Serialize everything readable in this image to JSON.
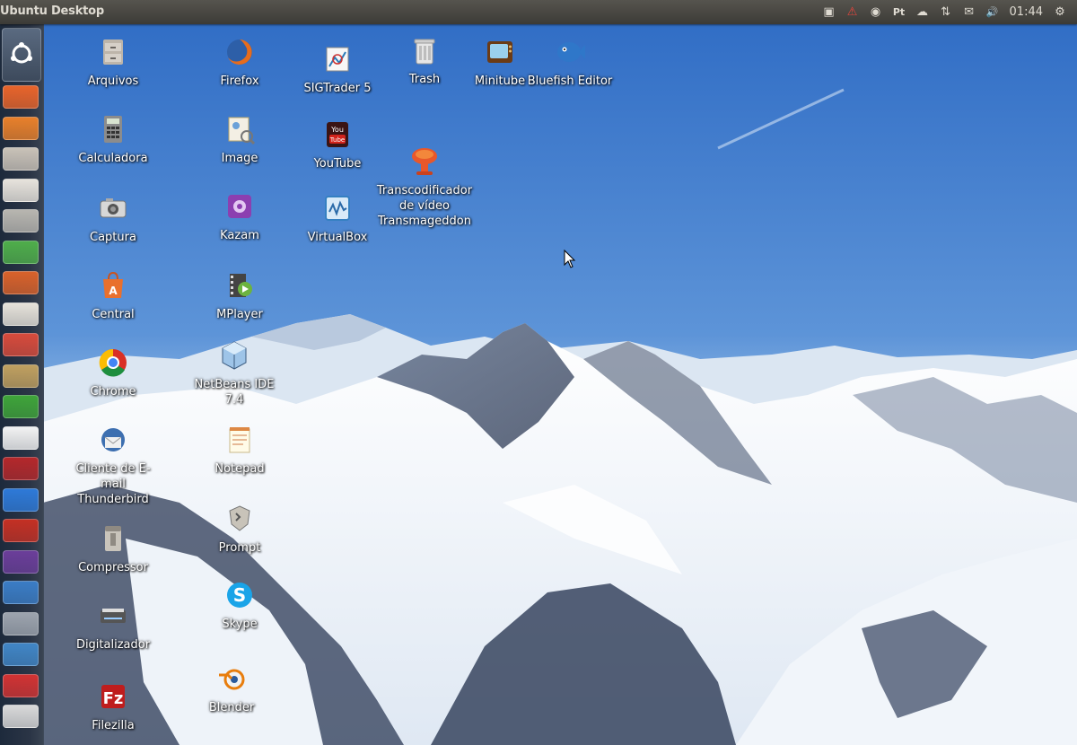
{
  "panel": {
    "title": "Ubuntu Desktop",
    "clock": "01:44",
    "indicators": [
      {
        "name": "screen-record-icon",
        "glyph": "▣"
      },
      {
        "name": "warning-icon",
        "glyph": "⚠"
      },
      {
        "name": "update-icon",
        "glyph": "◉"
      },
      {
        "name": "pt-keyboard-icon",
        "glyph": "Pt"
      },
      {
        "name": "cloud-icon",
        "glyph": "☁"
      },
      {
        "name": "network-icon",
        "glyph": "⇅"
      },
      {
        "name": "mail-icon",
        "glyph": "✉"
      },
      {
        "name": "volume-icon",
        "glyph": "🔊"
      },
      {
        "name": "settings-gear-icon",
        "glyph": "⚙"
      }
    ]
  },
  "launcher_items": [
    {
      "name": "launcher-software-center",
      "color": "#e8642b"
    },
    {
      "name": "launcher-firefox",
      "color": "#e8802b"
    },
    {
      "name": "launcher-files",
      "color": "#c9c2b8"
    },
    {
      "name": "launcher-writer",
      "color": "#e7e3dc"
    },
    {
      "name": "launcher-calculator",
      "color": "#b8b6b0"
    },
    {
      "name": "launcher-calc",
      "color": "#4fae4b"
    },
    {
      "name": "launcher-impress",
      "color": "#d9622b"
    },
    {
      "name": "launcher-presentation",
      "color": "#e6e2da"
    },
    {
      "name": "launcher-burner",
      "color": "#d84b3c"
    },
    {
      "name": "launcher-ftp",
      "color": "#c0a060"
    },
    {
      "name": "launcher-chat",
      "color": "#3fa43a"
    },
    {
      "name": "launcher-gmail",
      "color": "#f2f2f2"
    },
    {
      "name": "launcher-filezilla",
      "color": "#b4282b"
    },
    {
      "name": "launcher-chrome",
      "color": "#2e7ad8"
    },
    {
      "name": "launcher-youtube",
      "color": "#c43024"
    },
    {
      "name": "launcher-mail",
      "color": "#6b3e9a"
    },
    {
      "name": "launcher-web",
      "color": "#3b7dc6"
    },
    {
      "name": "launcher-webcam",
      "color": "#9da4ae"
    },
    {
      "name": "launcher-tv",
      "color": "#4186c6"
    },
    {
      "name": "launcher-unlink",
      "color": "#d23333"
    },
    {
      "name": "launcher-trash",
      "color": "#d9d9d9"
    }
  ],
  "desktop_icons": [
    {
      "label": "Arquivos",
      "icon": "file-cabinet-icon"
    },
    {
      "label": "Calculadora",
      "icon": "calculator-icon"
    },
    {
      "label": "Captura",
      "icon": "camera-icon"
    },
    {
      "label": "Central",
      "icon": "software-center-icon"
    },
    {
      "label": "Chrome",
      "icon": "chrome-icon"
    },
    {
      "label": "Cliente de E-mail Thunderbird",
      "icon": "thunderbird-icon"
    },
    {
      "label": "Compressor",
      "icon": "compressor-icon"
    },
    {
      "label": "Digitalizador",
      "icon": "scanner-icon"
    },
    {
      "label": "Filezilla",
      "icon": "filezilla-icon"
    },
    {
      "label": "Firefox",
      "icon": "firefox-icon"
    },
    {
      "label": "Image",
      "icon": "image-viewer-icon"
    },
    {
      "label": "Kazam",
      "icon": "kazam-icon"
    },
    {
      "label": "MPlayer",
      "icon": "mplayer-icon"
    },
    {
      "label": "NetBeans IDE 7.4",
      "icon": "netbeans-icon"
    },
    {
      "label": "Notepad",
      "icon": "notepad-icon"
    },
    {
      "label": "Prompt",
      "icon": "terminal-icon"
    },
    {
      "label": "Skype",
      "icon": "skype-icon"
    },
    {
      "label": "Blender",
      "icon": "blender-icon"
    },
    {
      "label": "SIGTrader 5",
      "icon": "sigtrader-icon"
    },
    {
      "label": "YouTube",
      "icon": "youtube-icon"
    },
    {
      "label": "VirtualBox",
      "icon": "virtualbox-icon"
    },
    {
      "label": "Trash",
      "icon": "trash-icon"
    },
    {
      "label": "Transcodificador de vídeo Transmageddon",
      "icon": "transmageddon-icon"
    },
    {
      "label": "Minitube",
      "icon": "minitube-icon"
    },
    {
      "label": "Bluefish Editor",
      "icon": "bluefish-icon"
    }
  ],
  "colors": {
    "sky_top": "#2f6cc6",
    "sky_bottom": "#9cc3ea",
    "snow": "#f4f7fb",
    "rock": "#3a4a63",
    "panel": "#3c3b37"
  }
}
